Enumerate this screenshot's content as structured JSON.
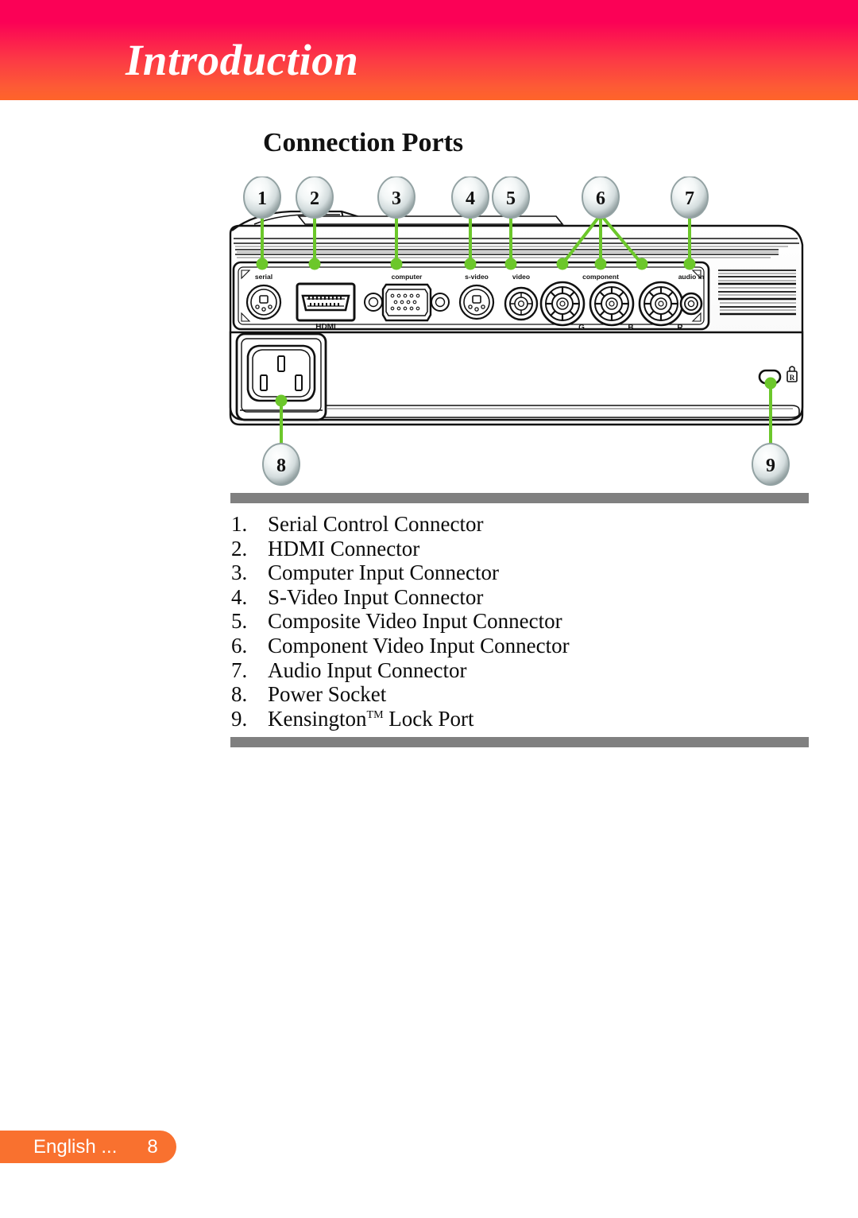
{
  "header": {
    "chapter_title": "Introduction",
    "gradient_top": "#FB0156",
    "gradient_bottom": "#FE6429"
  },
  "section": {
    "heading": "Connection Ports"
  },
  "diagram": {
    "name": "projector-rear-connection-panel",
    "callout_line_color": "#6CC72B",
    "callouts": [
      {
        "number": "1",
        "target": "serial"
      },
      {
        "number": "2",
        "target": "HDMI"
      },
      {
        "number": "3",
        "target": "computer"
      },
      {
        "number": "4",
        "target": "s-video"
      },
      {
        "number": "5",
        "target": "video"
      },
      {
        "number": "6",
        "target": "component"
      },
      {
        "number": "7",
        "target": "audio in"
      },
      {
        "number": "8",
        "target": "power socket"
      },
      {
        "number": "9",
        "target": "kensington lock"
      }
    ],
    "port_labels": {
      "serial": "serial",
      "hdmi": "HDMI",
      "computer": "computer",
      "svideo": "s-video",
      "video": "video",
      "component": "component",
      "component_g": "G",
      "component_b": "B",
      "component_r": "R",
      "audio_in": "audio in"
    }
  },
  "list": {
    "items": [
      {
        "num": "1.",
        "text": "Serial Control Connector"
      },
      {
        "num": "2.",
        "text": "HDMI Connector"
      },
      {
        "num": "3.",
        "text": "Computer Input Connector"
      },
      {
        "num": "4.",
        "text": "S-Video Input Connector"
      },
      {
        "num": "5.",
        "text": "Composite Video Input Connector"
      },
      {
        "num": "6.",
        "text": "Component Video Input Connector"
      },
      {
        "num": "7.",
        "text": "Audio Input Connector"
      },
      {
        "num": "8.",
        "text": "Power Socket"
      },
      {
        "num": "9.",
        "text": "Kensington",
        "sup": "TM",
        "text_after": " Lock Port"
      }
    ],
    "rule_color": "#808080"
  },
  "footer": {
    "language": "English ...",
    "page_number": "8",
    "pill_color": "#F9712F"
  }
}
